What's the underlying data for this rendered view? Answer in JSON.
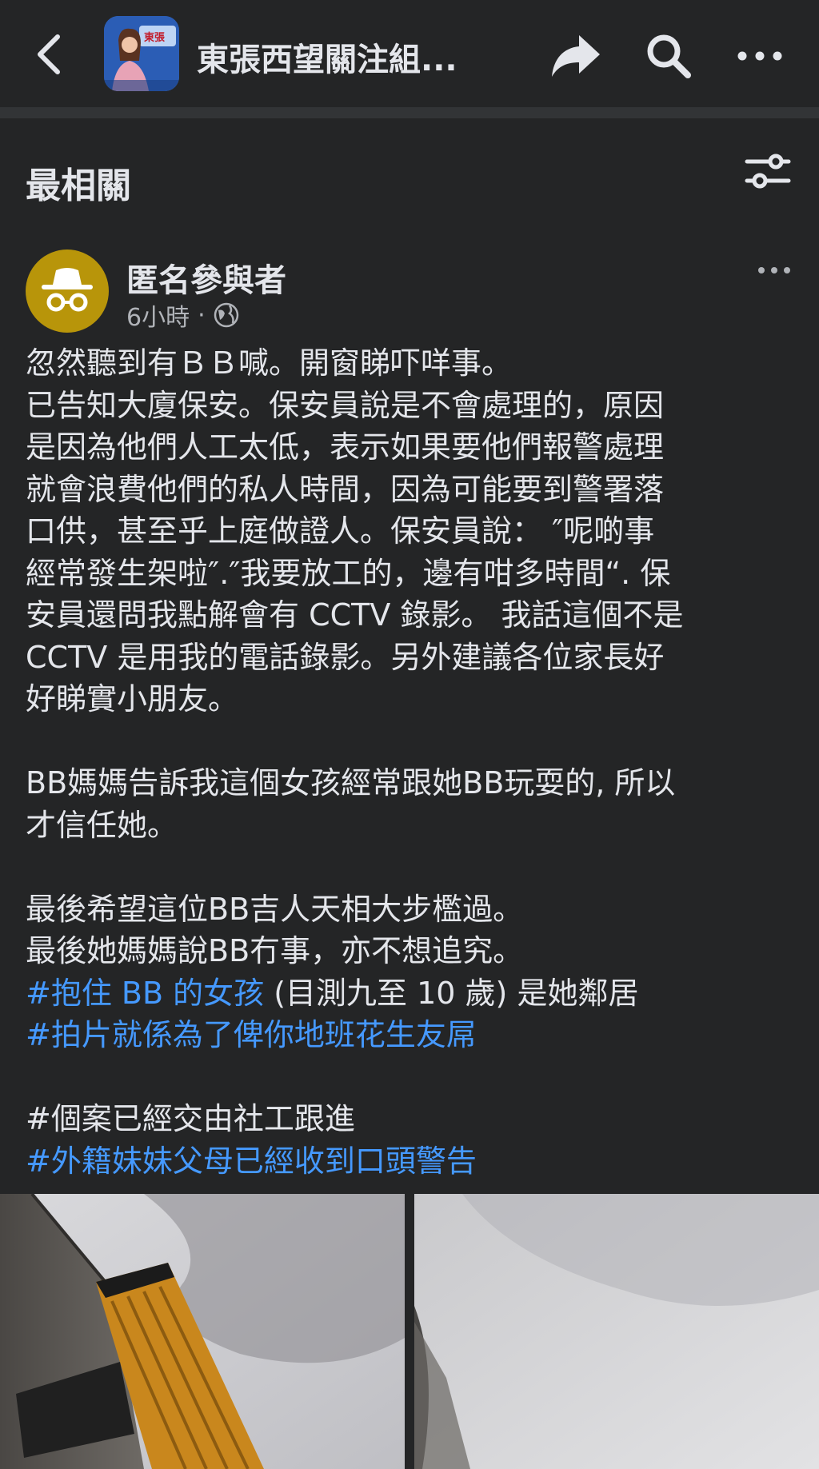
{
  "header": {
    "group_title": "東張西望關注組...",
    "back_icon": "chevron-left-icon",
    "share_icon": "share-arrow-icon",
    "search_icon": "search-icon",
    "more_icon": "more-horizontal-icon"
  },
  "feed": {
    "sort_label": "最相關",
    "filter_icon": "filter-sliders-icon"
  },
  "post": {
    "author": "匿名參與者",
    "time": "6小時",
    "separator": "·",
    "privacy_icon": "globe-icon",
    "lines": [
      "忽然聽到有ＢＢ喊。開窗睇吓咩事。",
      "已告知大廈保安。保安員說是不會處理的，原因",
      "是因為他們人工太低，表示如果要他們報警處理",
      "就會浪費他們的私人時間，因為可能要到警署落",
      "口供，甚至乎上庭做證人。保安員說：  ″呢啲事",
      "經常發生架啦″.″我要放工的，邊有咁多時間“. 保",
      "安員還問我點解會有 CCTV 錄影。 我話這個不是",
      " CCTV 是用我的電話錄影。另外建議各位家長好",
      "好睇實小朋友。",
      "BB媽媽告訴我這個女孩經常跟她BB玩耍的, 所以",
      "才信任她。",
      "最後希望這位BB吉人天相大步檻過。",
      "最後她媽媽說BB冇事，亦不想追究。"
    ],
    "hashtag_1": "#抱住 BB 的女孩",
    "hashtag_1_suffix": " (目測九至 10 歲) 是她鄰居",
    "hashtag_2": "#拍片就係為了俾你地班花生友屌",
    "plain_tag": "#個案已經交由社工跟進",
    "hashtag_3": "#外籍妹妹父母已經收到口頭警告"
  },
  "colors": {
    "background": "#242526",
    "text": "#e4e6eb",
    "secondary_text": "#b0b3b8",
    "hashtag": "#4599ff",
    "anonymous_avatar": "#b8950a"
  }
}
